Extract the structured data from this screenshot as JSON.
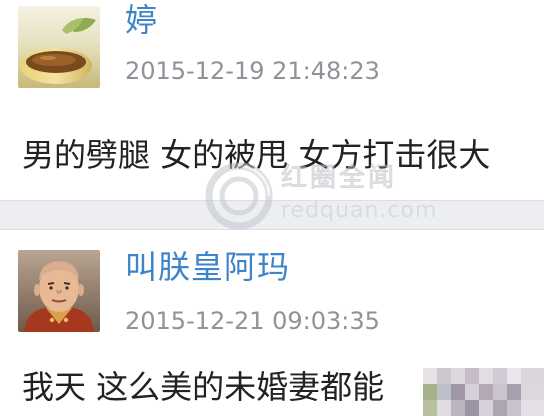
{
  "comments": [
    {
      "username": "婷",
      "timestamp": "2015-12-19 21:48:23",
      "content": "男的劈腿 女的被甩 女方打击很大",
      "avatar_icon": "teacup-avatar-icon"
    },
    {
      "username": "叫朕皇阿玛",
      "timestamp": "2015-12-21 09:03:35",
      "content": "我天 这么美的未婚妻都能",
      "avatar_icon": "emperor-avatar-icon"
    }
  ],
  "watermark": {
    "chinese": "红圈全闻",
    "english": "redquan.com"
  },
  "colors": {
    "username": "#3f84c8",
    "timestamp": "#8e939a",
    "content": "#222222",
    "divider": "#eceef1"
  }
}
